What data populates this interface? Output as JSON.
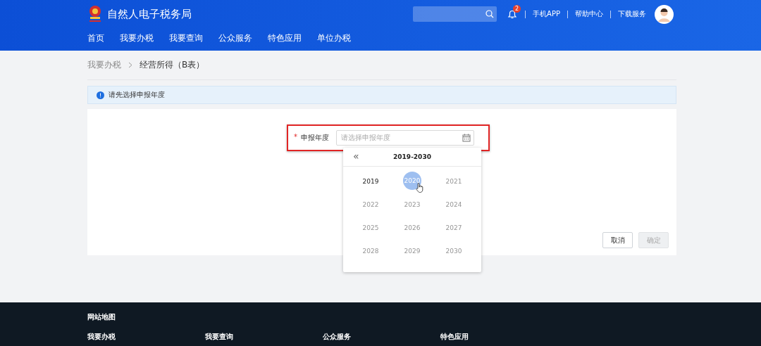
{
  "header": {
    "site_title": "自然人电子税务局",
    "notification_count": "2",
    "links": [
      "手机APP",
      "帮助中心",
      "下载服务"
    ]
  },
  "nav": [
    {
      "label": "首页",
      "selected": false
    },
    {
      "label": "我要办税",
      "selected": false
    },
    {
      "label": "我要查询",
      "selected": false
    },
    {
      "label": "公众服务",
      "selected": false
    },
    {
      "label": "特色应用",
      "selected": false
    },
    {
      "label": "单位办税",
      "selected": false
    }
  ],
  "breadcrumb": [
    "我要办税",
    "经营所得（B表）"
  ],
  "alert": "请先选择申报年度",
  "form": {
    "required_mark": "*",
    "label": "申报年度",
    "placeholder": "请选择申报年度",
    "highlighted": true
  },
  "year_picker": {
    "prev": "«",
    "range": "2019-2030",
    "years": [
      {
        "label": "2019",
        "selected": false,
        "disabled": false
      },
      {
        "label": "2020",
        "selected": true,
        "disabled": false
      },
      {
        "label": "2021",
        "selected": false,
        "disabled": true
      },
      {
        "label": "2022",
        "selected": false,
        "disabled": true
      },
      {
        "label": "2023",
        "selected": false,
        "disabled": true
      },
      {
        "label": "2024",
        "selected": false,
        "disabled": true
      },
      {
        "label": "2025",
        "selected": false,
        "disabled": true
      },
      {
        "label": "2026",
        "selected": false,
        "disabled": true
      },
      {
        "label": "2027",
        "selected": false,
        "disabled": true
      },
      {
        "label": "2028",
        "selected": false,
        "disabled": true
      },
      {
        "label": "2029",
        "selected": false,
        "disabled": true
      },
      {
        "label": "2030",
        "selected": false,
        "disabled": true
      }
    ]
  },
  "buttons": [
    {
      "label": "取消",
      "disabled": false
    },
    {
      "label": "确定",
      "disabled": true
    }
  ],
  "footer": {
    "title": "网站地图",
    "columns": [
      "我要办税",
      "我要查询",
      "公众服务",
      "特色应用"
    ]
  }
}
